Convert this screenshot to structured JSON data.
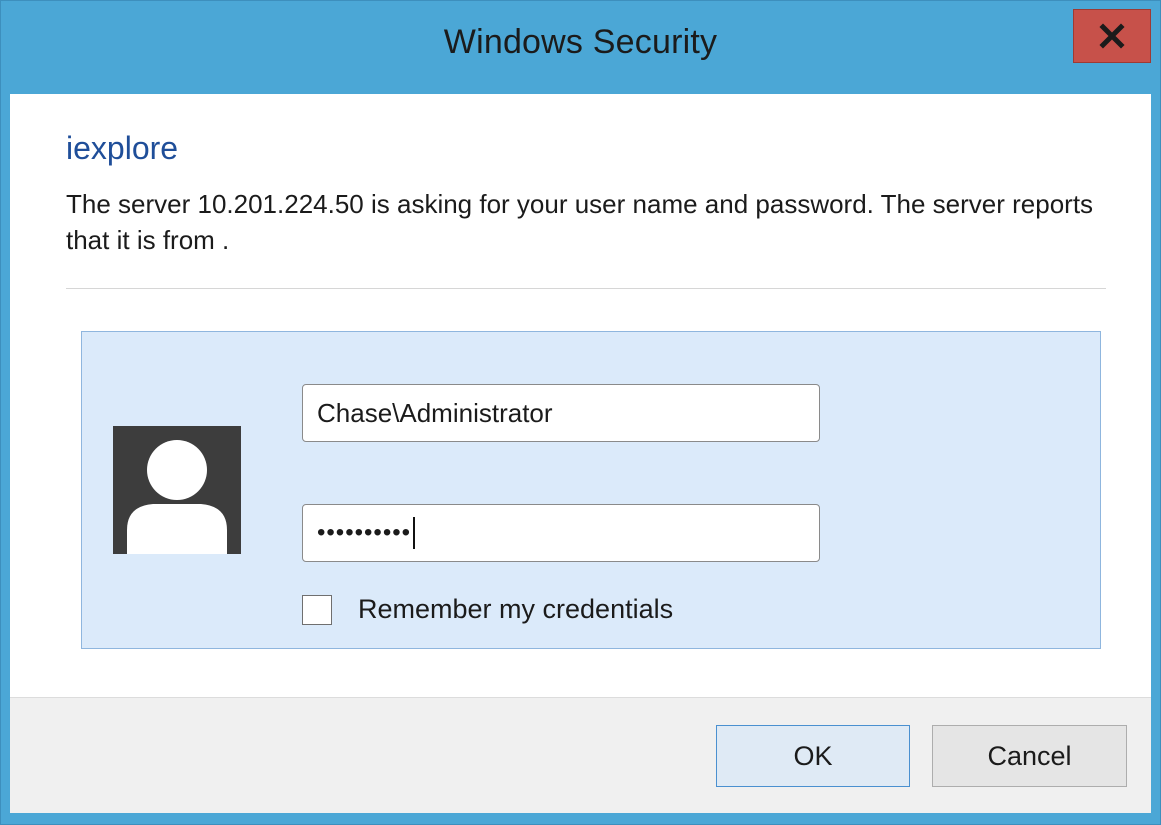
{
  "window": {
    "title": "Windows Security",
    "close_label": "x",
    "accent": "#4ba7d6",
    "close_color": "#c7514a"
  },
  "dialog": {
    "app_name": "iexplore",
    "message": "The server 10.201.224.50 is asking for your user name and password. The server reports that it is from ."
  },
  "credentials": {
    "avatar_icon": "user-avatar-icon",
    "username_value": "Chase\\Administrator",
    "password_value": "••••••••••",
    "remember_label": "Remember my credentials",
    "remember_checked": false
  },
  "buttons": {
    "ok_label": "OK",
    "cancel_label": "Cancel"
  }
}
